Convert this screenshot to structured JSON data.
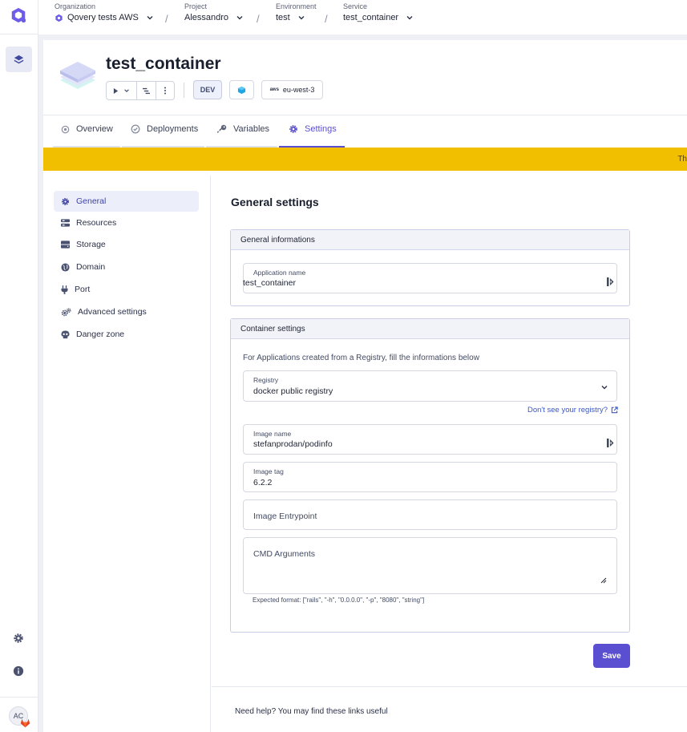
{
  "breadcrumb": [
    {
      "label": "Organization",
      "value": "Qovery tests AWS"
    },
    {
      "label": "Project",
      "value": "Alessandro"
    },
    {
      "label": "Environment",
      "value": "test"
    },
    {
      "label": "Service",
      "value": "test_container"
    }
  ],
  "breadcrumb_separator": "/",
  "user": {
    "initials": "AC"
  },
  "app": {
    "title": "test_container",
    "env_type": "DEV",
    "region": "eu-west-3",
    "cloud": "aws"
  },
  "tabs": [
    {
      "label": "Overview",
      "icon": "circle-dot-icon"
    },
    {
      "label": "Deployments",
      "icon": "check-circle-icon"
    },
    {
      "label": "Variables",
      "icon": "key-icon"
    },
    {
      "label": "Settings",
      "icon": "gear-icon",
      "active": true
    }
  ],
  "banner": {
    "text": "Th"
  },
  "settings_nav": [
    {
      "label": "General",
      "icon": "gear-icon",
      "active": true
    },
    {
      "label": "Resources",
      "icon": "resources-icon"
    },
    {
      "label": "Storage",
      "icon": "storage-icon"
    },
    {
      "label": "Domain",
      "icon": "globe-icon"
    },
    {
      "label": "Port",
      "icon": "plug-icon"
    },
    {
      "label": "Advanced settings",
      "icon": "gears-icon"
    },
    {
      "label": "Danger zone",
      "icon": "skull-icon"
    }
  ],
  "main": {
    "title": "General settings",
    "general_card": {
      "title": "General informations",
      "app_name_label": "Application name",
      "app_name_value": "test_container"
    },
    "container_card": {
      "title": "Container settings",
      "note": "For Applications created from a Registry, fill the informations below",
      "registry_label": "Registry",
      "registry_value": "docker public registry",
      "registry_link": "Don't see your registry?",
      "image_name_label": "Image name",
      "image_name_value": "stefanprodan/podinfo",
      "image_tag_label": "Image tag",
      "image_tag_value": "6.2.2",
      "entrypoint_placeholder": "Image Entrypoint",
      "cmd_placeholder": "CMD Arguments",
      "cmd_hint": "Expected format: [\"rails\", \"-h\", \"0.0.0.0\", \"-p\", \"8080\", \"string\"]"
    },
    "save_label": "Save",
    "help_text": "Need help? You may find these links useful"
  },
  "colors": {
    "accent": "#5b4fd1",
    "banner": "#f2bf00",
    "link": "#3a56c4"
  }
}
